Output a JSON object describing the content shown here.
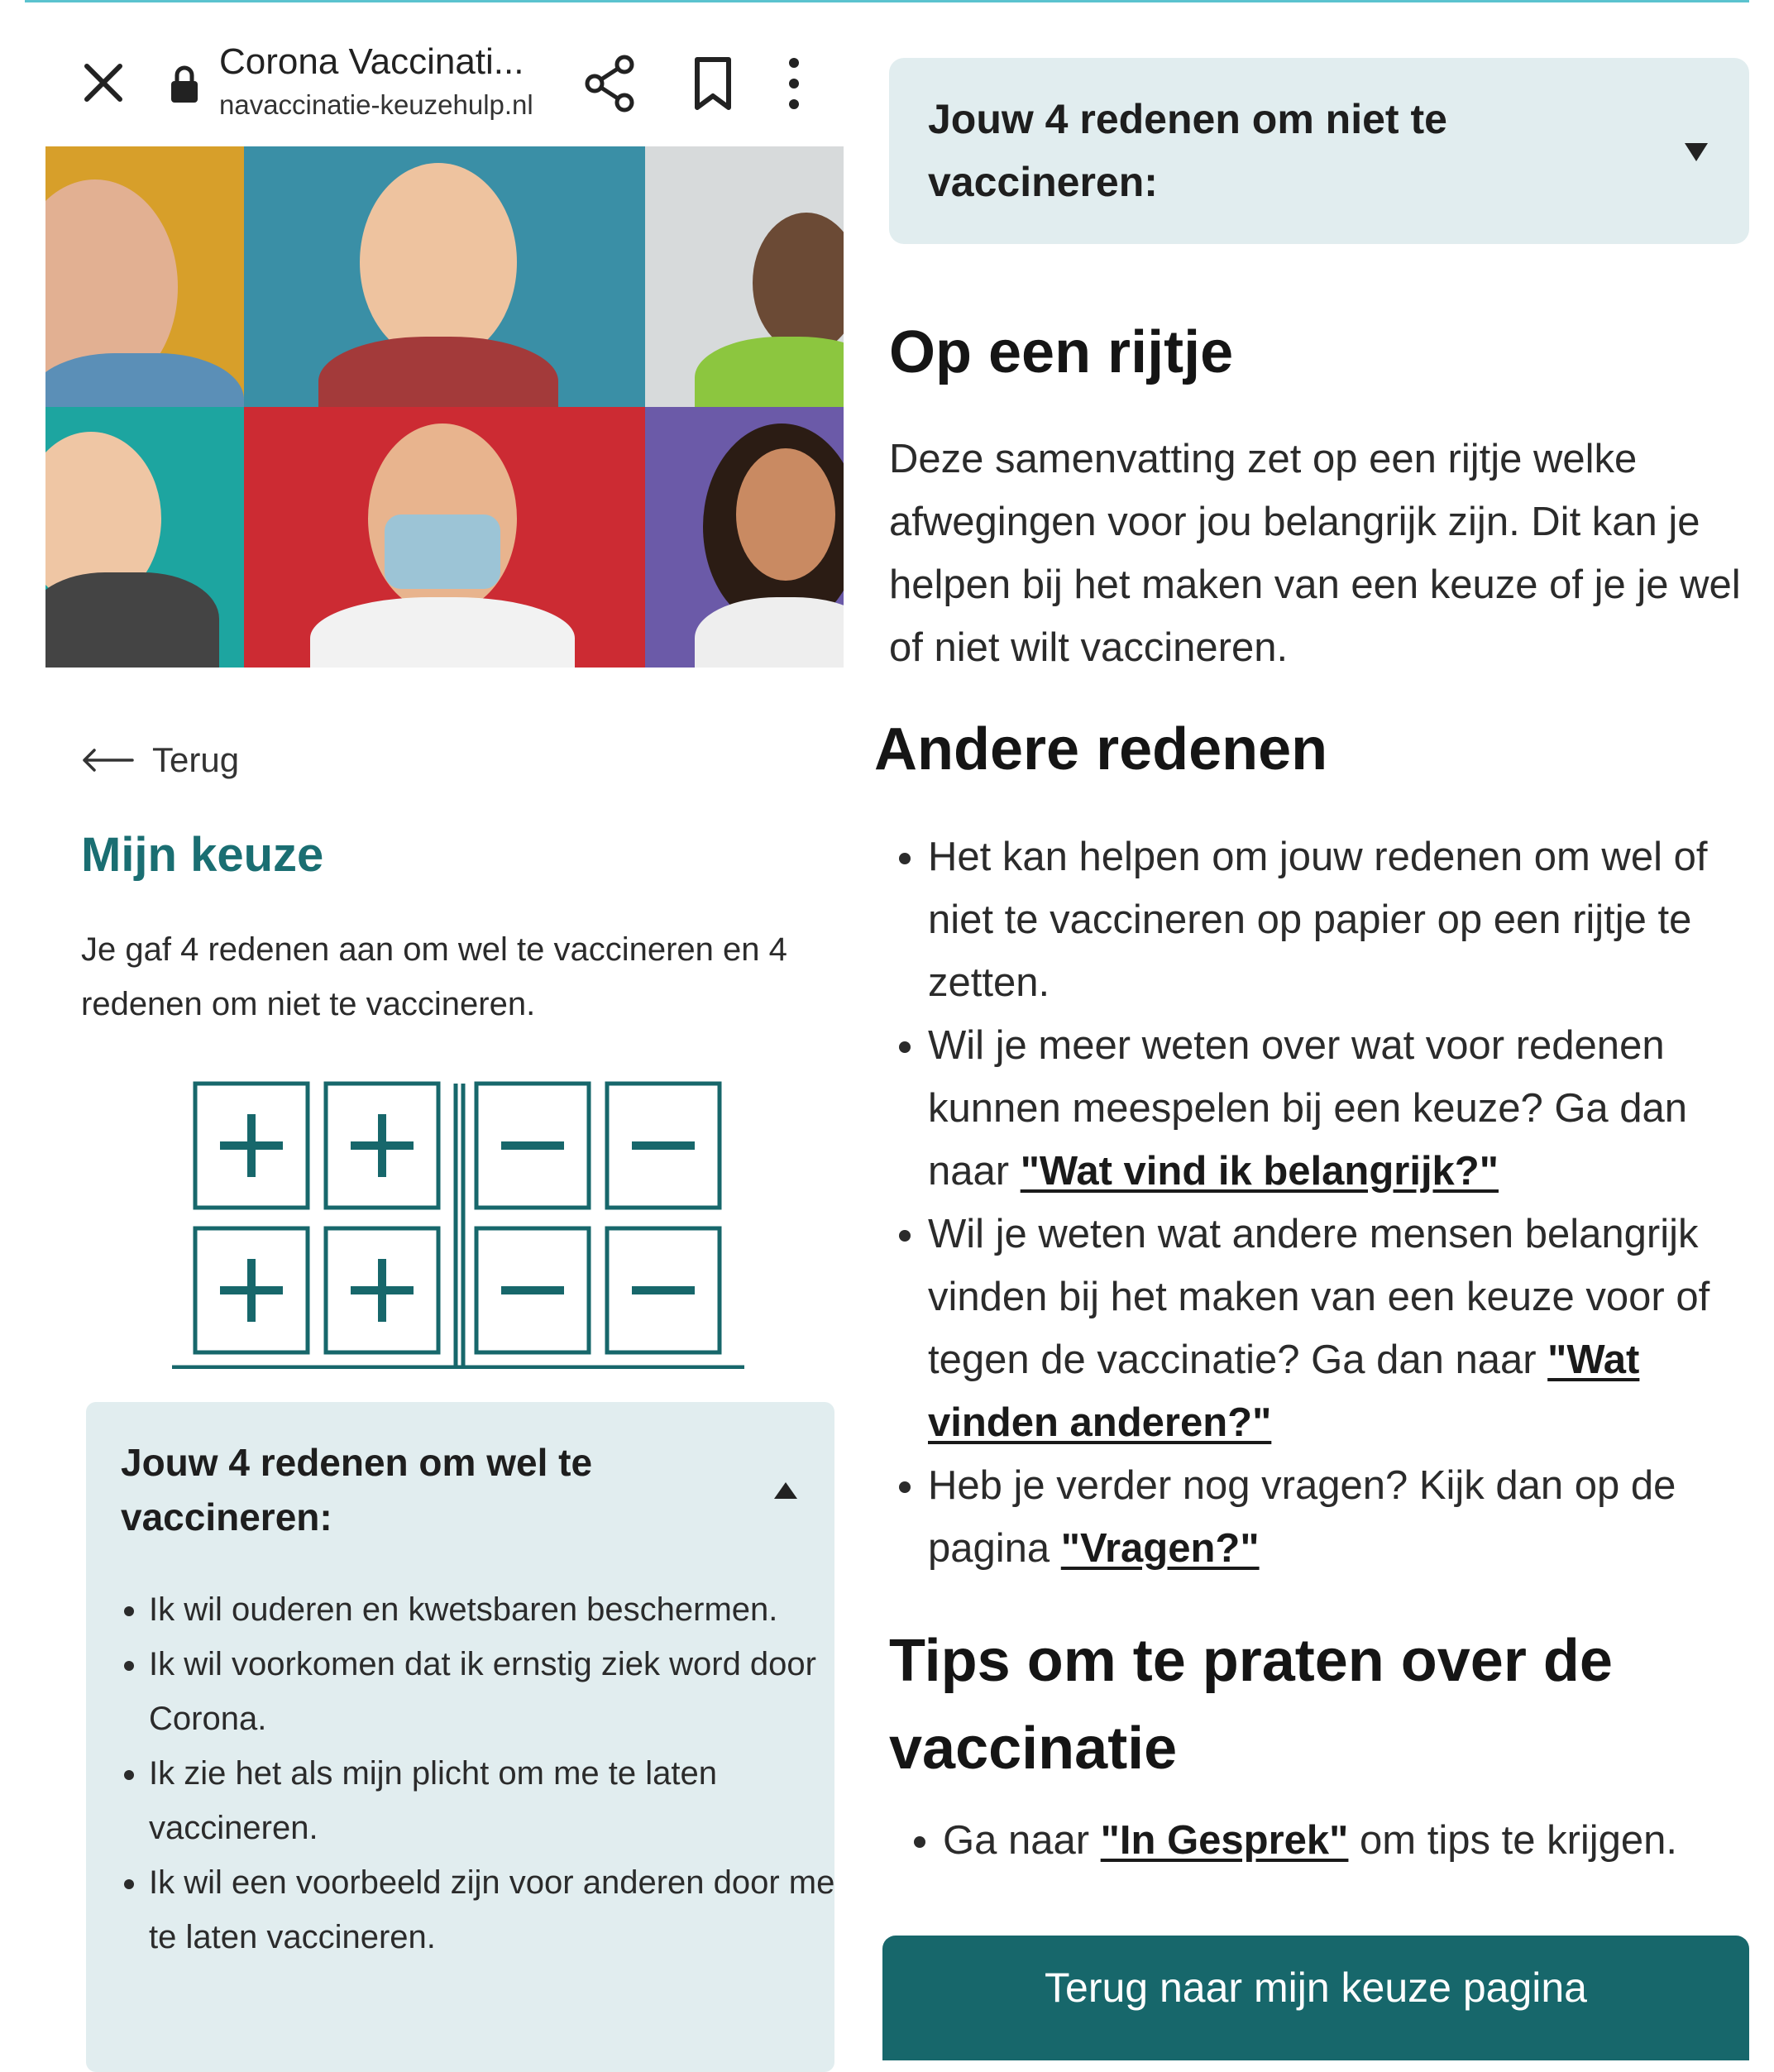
{
  "browser": {
    "title": "Corona Vaccinati...",
    "url": "navaccinatie-keuzehulp.nl"
  },
  "left": {
    "back_label": "Terug",
    "heading": "Mijn keuze",
    "intro": "Je gaf 4 redenen aan om wel te vaccineren en 4 redenen om niet te vaccineren.",
    "diagram": {
      "plus_count": 4,
      "minus_count": 4
    },
    "accordion_pro": {
      "title": "Jouw 4 redenen om wel te vaccineren:",
      "items": [
        "Ik wil ouderen en kwetsbaren beschermen.",
        "Ik wil voorkomen dat ik ernstig ziek word door Corona.",
        "Ik zie het als mijn plicht om me te laten vaccineren.",
        "Ik wil een voorbeeld zijn voor anderen door me te laten vaccineren."
      ]
    }
  },
  "right": {
    "accordion_con": {
      "title": "Jouw 4 redenen om niet te vaccineren:"
    },
    "summary_heading": "Op een rijtje",
    "summary_text": "Deze samenvatting zet op een rijtje welke afwegingen voor jou belangrijk zijn. Dit kan je helpen bij het maken van een keuze of je je wel of niet wilt vaccineren.",
    "other_heading": "Andere redenen",
    "other_items": [
      {
        "text": "Het kan helpen om jouw redenen om wel of niet te vaccineren op papier op een rijtje te zetten."
      },
      {
        "text": "Wil je meer weten over wat voor redenen kunnen meespelen bij een keuze? Ga dan naar ",
        "link": "\"Wat vind ik belangrijk?\""
      },
      {
        "text": "Wil je weten wat andere mensen belangrijk vinden bij het maken van een keuze voor of tegen de vaccinatie? Ga dan naar ",
        "link": "\"Wat vinden anderen?\""
      },
      {
        "text": "Heb je verder nog vragen? Kijk dan op de pagina ",
        "link": "\"Vragen?\""
      }
    ],
    "tips_heading": "Tips om te praten over de vaccinatie",
    "tips_pre": "Ga naar ",
    "tips_link": "\"In Gesprek\"",
    "tips_post": " om tips te krijgen.",
    "cta_label": "Terug naar mijn keuze pagina"
  },
  "colors": {
    "accent": "#17676b",
    "heading_teal": "#1a6e72",
    "panel_bg": "#e1edef"
  },
  "icons": [
    "close-icon",
    "lock-icon",
    "share-icon",
    "bookmark-icon",
    "more-vert-icon",
    "arrow-left-icon",
    "caret-up-icon",
    "caret-down-icon"
  ]
}
